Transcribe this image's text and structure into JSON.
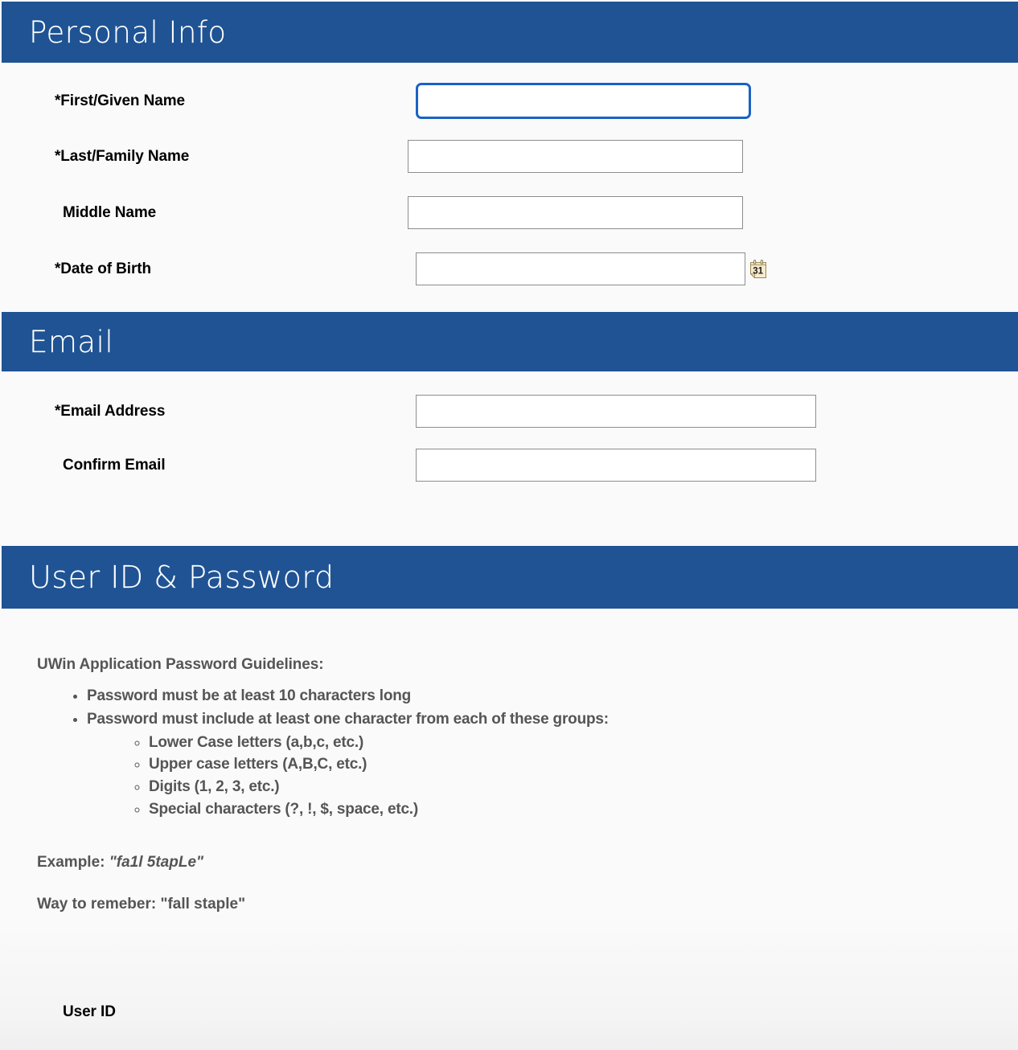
{
  "theme": {
    "banner_blue": "#1f5394",
    "focus_blue": "#1a62c4",
    "page_background": "#fafafa",
    "label_color": "#000000",
    "guidelines_color": "#555555",
    "input_border": "#8d8d8d"
  },
  "sections": {
    "personal_info": {
      "title": "Personal Info",
      "fields": [
        {
          "label": "*First/Given Name",
          "value": "",
          "placeholder": "",
          "focused": true
        },
        {
          "label": "*Last/Family Name",
          "value": "",
          "placeholder": "",
          "focused": false
        },
        {
          "label": "Middle Name",
          "value": "",
          "placeholder": "",
          "focused": false
        },
        {
          "label": "*Date of Birth",
          "value": "",
          "placeholder": "",
          "focused": false,
          "icon": "calendar-icon",
          "icon_day": "31"
        }
      ]
    },
    "email": {
      "title": "Email",
      "fields": [
        {
          "label": "*Email Address",
          "value": "",
          "placeholder": ""
        },
        {
          "label": "Confirm Email",
          "value": "",
          "placeholder": ""
        }
      ]
    },
    "user_id_password": {
      "title": "User ID & Password",
      "guidelines_title": "UWin Application Password Guidelines:",
      "bullets": [
        {
          "text": "Password must be at least 10 characters long",
          "sub": []
        },
        {
          "text": "Password must include at least one character from each of these groups:",
          "sub": [
            "Lower Case letters (a,b,c, etc.)",
            "Upper case letters (A,B,C, etc.)",
            "Digits (1, 2, 3, etc.)",
            "Special characters (?, !, $, space, etc.)"
          ]
        }
      ],
      "example_label": "Example:",
      "example_value": "\"fa1l 5tapLe\"",
      "remember_line": "Way to remeber: \"fall staple\"",
      "fields": [
        {
          "label": "User ID",
          "value": "",
          "placeholder": ""
        }
      ]
    }
  }
}
